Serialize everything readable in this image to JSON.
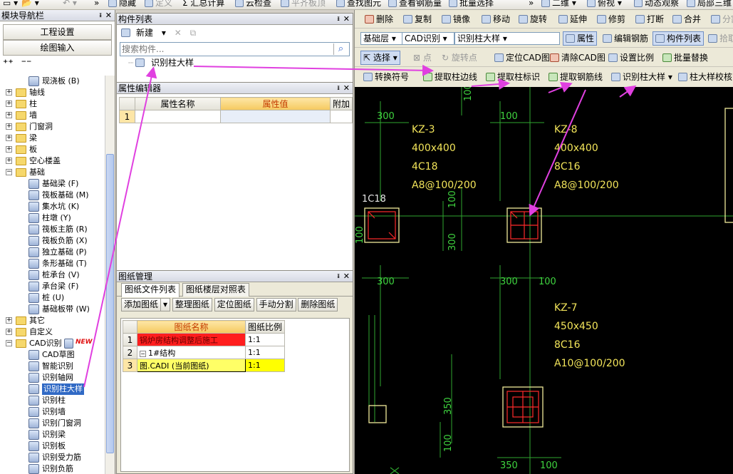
{
  "topbar": {
    "items": [
      "隐藏",
      "定义",
      "汇总计算",
      "云检查",
      "平齐板顶",
      "查看钢筋量",
      "批量选择",
      "二维",
      "俯视",
      "动态观察",
      "局部三维"
    ]
  },
  "leftnav": {
    "title": "模块导航栏",
    "pin": "ᵻ",
    "close": "✕",
    "btn_engineering": "工程设置",
    "btn_drawing": "绘图输入",
    "tree": [
      {
        "label": "现浇板 (B)",
        "level": 2,
        "type": "item"
      },
      {
        "label": "轴线",
        "level": 0,
        "type": "folder",
        "exp": "+"
      },
      {
        "label": "柱",
        "level": 0,
        "type": "folder",
        "exp": "+"
      },
      {
        "label": "墙",
        "level": 0,
        "type": "folder",
        "exp": "+"
      },
      {
        "label": "门窗洞",
        "level": 0,
        "type": "folder",
        "exp": "+"
      },
      {
        "label": "梁",
        "level": 0,
        "type": "folder",
        "exp": "+"
      },
      {
        "label": "板",
        "level": 0,
        "type": "folder",
        "exp": "+"
      },
      {
        "label": "空心楼盖",
        "level": 0,
        "type": "folder",
        "exp": "+"
      },
      {
        "label": "基础",
        "level": 0,
        "type": "folder",
        "exp": "−"
      },
      {
        "label": "基础梁 (F)",
        "level": 2,
        "type": "item"
      },
      {
        "label": "筏板基础 (M)",
        "level": 2,
        "type": "item"
      },
      {
        "label": "集水坑 (K)",
        "level": 2,
        "type": "item"
      },
      {
        "label": "柱墩 (Y)",
        "level": 2,
        "type": "item"
      },
      {
        "label": "筏板主筋 (R)",
        "level": 2,
        "type": "item"
      },
      {
        "label": "筏板负筋 (X)",
        "level": 2,
        "type": "item"
      },
      {
        "label": "独立基础 (P)",
        "level": 2,
        "type": "item"
      },
      {
        "label": "条形基础 (T)",
        "level": 2,
        "type": "item"
      },
      {
        "label": "桩承台 (V)",
        "level": 2,
        "type": "item"
      },
      {
        "label": "承台梁 (F)",
        "level": 2,
        "type": "item"
      },
      {
        "label": "桩 (U)",
        "level": 2,
        "type": "item"
      },
      {
        "label": "基础板带 (W)",
        "level": 2,
        "type": "item"
      },
      {
        "label": "其它",
        "level": 0,
        "type": "folder",
        "exp": "+"
      },
      {
        "label": "自定义",
        "level": 0,
        "type": "folder",
        "exp": "+"
      },
      {
        "label": "CAD识别",
        "level": 0,
        "type": "folder",
        "exp": "−",
        "badge": "NEW"
      },
      {
        "label": "CAD草图",
        "level": 2,
        "type": "item"
      },
      {
        "label": "智能识别",
        "level": 2,
        "type": "item"
      },
      {
        "label": "识别轴网",
        "level": 2,
        "type": "item"
      },
      {
        "label": "识别柱大样",
        "level": 2,
        "type": "item",
        "selected": true
      },
      {
        "label": "识别柱",
        "level": 2,
        "type": "item"
      },
      {
        "label": "识别墙",
        "level": 2,
        "type": "item"
      },
      {
        "label": "识别门窗洞",
        "level": 2,
        "type": "item"
      },
      {
        "label": "识别梁",
        "level": 2,
        "type": "item"
      },
      {
        "label": "识别板",
        "level": 2,
        "type": "item"
      },
      {
        "label": "识别受力筋",
        "level": 2,
        "type": "item"
      },
      {
        "label": "识别负筋",
        "level": 2,
        "type": "item"
      }
    ]
  },
  "component_list": {
    "title": "构件列表",
    "new_btn": "新建",
    "search_placeholder": "搜索构件...",
    "item": "识别柱大样"
  },
  "property_editor": {
    "title": "属性编辑器",
    "col_name": "属性名称",
    "col_value": "属性值",
    "col_extra": "附加",
    "row1": "1"
  },
  "drawing_manager": {
    "title": "图纸管理",
    "tab1": "图纸文件列表",
    "tab2": "图纸楼层对照表",
    "buttons": [
      "添加图纸",
      "整理图纸",
      "定位图纸",
      "手动分割",
      "删除图纸"
    ],
    "col_name": "图纸名称",
    "col_scale": "图纸比例",
    "rows": [
      {
        "n": "1",
        "name": "锅炉房结构调整后施工",
        "scale": "1:1"
      },
      {
        "n": "2",
        "name": "1#结构",
        "scale": "1:1"
      },
      {
        "n": "3",
        "name": "图.CADI (当前图纸)",
        "scale": "1:1"
      }
    ]
  },
  "toolbar1": {
    "delete": "删除",
    "copy": "复制",
    "mirror": "镜像",
    "move": "移动",
    "rotate": "旋转",
    "extend": "延伸",
    "trim": "修剪",
    "break": "打断",
    "merge": "合并",
    "split": "分割"
  },
  "toolbar2": {
    "layer": "基础层",
    "cad": "CAD识别",
    "comp": "识别柱大样",
    "property": "属性",
    "edit_rebar": "编辑钢筋",
    "comp_list": "构件列表",
    "pick": "拾取"
  },
  "toolbar3": {
    "select": "选择",
    "point": "点",
    "rotate_point": "旋转点",
    "locate_cad": "定位CAD图",
    "clear_cad": "清除CAD图",
    "set_scale": "设置比例",
    "batch_replace": "批量替换"
  },
  "toolbar4": {
    "convert": "转换符号",
    "col_edge": "提取柱边线",
    "col_mark": "提取柱标识",
    "rebar_line": "提取钢筋线",
    "identify": "识别柱大样",
    "check": "柱大样校核"
  },
  "canvas": {
    "dims": {
      "d300a": "300",
      "d100a": "100",
      "d1c18": "1C18",
      "d100b": "100",
      "d300b": "300",
      "d300c": "300",
      "d300d": "300",
      "d100c": "100",
      "d350": "350",
      "d100d": "100",
      "d350b": "350",
      "d100e": "100",
      "d100top": "100",
      "d100side": "100"
    },
    "labels": {
      "kz3_name": "KZ-3",
      "kz3_size": "400x400",
      "kz3_main": "4C18",
      "kz3_stir": "A8@100/200",
      "kz8_name": "KZ-8",
      "kz8_size": "400x400",
      "kz8_main": "8C16",
      "kz8_stir": "A8@100/200",
      "kz7_name": "KZ-7",
      "kz7_size": "450x450",
      "kz7_main": "8C16",
      "kz7_stir": "A10@100/200"
    },
    "colors": {
      "background": "#000000",
      "text": "#f2e45a",
      "dim": "#3fd43f",
      "rebar": "#ff2a2a",
      "annotation_arrow": "#e040e0"
    }
  }
}
